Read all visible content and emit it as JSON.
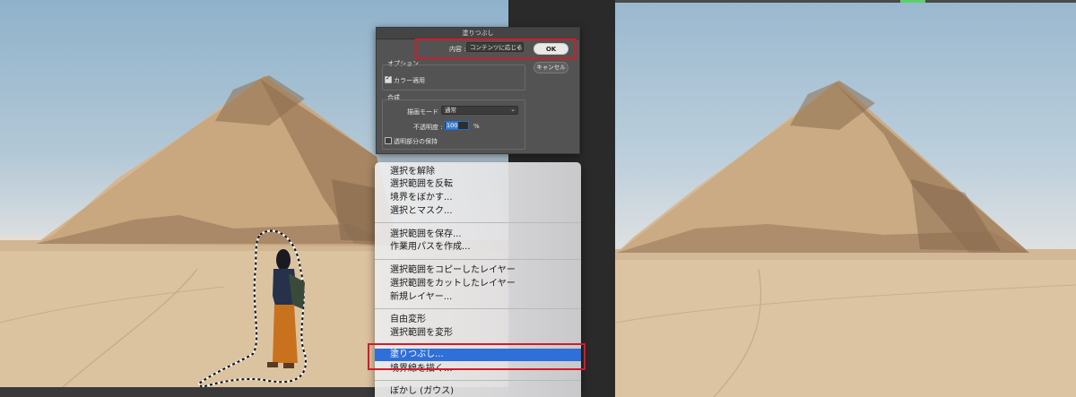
{
  "dialog": {
    "title": "塗りつぶし",
    "content_label": "内容 :",
    "content_value": "コンテンツに応じる",
    "ok_label": "OK",
    "cancel_label": "キャンセル",
    "options_title": "オプション",
    "color_adapt_label": "カラー適用",
    "color_adapt_checked": true,
    "blend_title": "合成",
    "mode_label": "描画モード :",
    "mode_value": "通常",
    "opacity_label": "不透明度 :",
    "opacity_value": "100",
    "opacity_unit": "%",
    "preserve_label": "透明部分の保持",
    "preserve_checked": false
  },
  "context_menu": {
    "items": [
      "選択を解除",
      "選択範囲を反転",
      "境界をぼかす...",
      "選択とマスク...",
      "選択範囲を保存...",
      "作業用パスを作成...",
      "選択範囲をコピーしたレイヤー",
      "選択範囲をカットしたレイヤー",
      "新規レイヤー...",
      "自由変形",
      "選択範囲を変形",
      "塗りつぶし...",
      "境界線を描く...",
      "ぼかし (ガウス)"
    ],
    "selected": "塗りつぶし..."
  },
  "highlight_color": "#d01c2a",
  "selection_color": "#2f6fd8"
}
